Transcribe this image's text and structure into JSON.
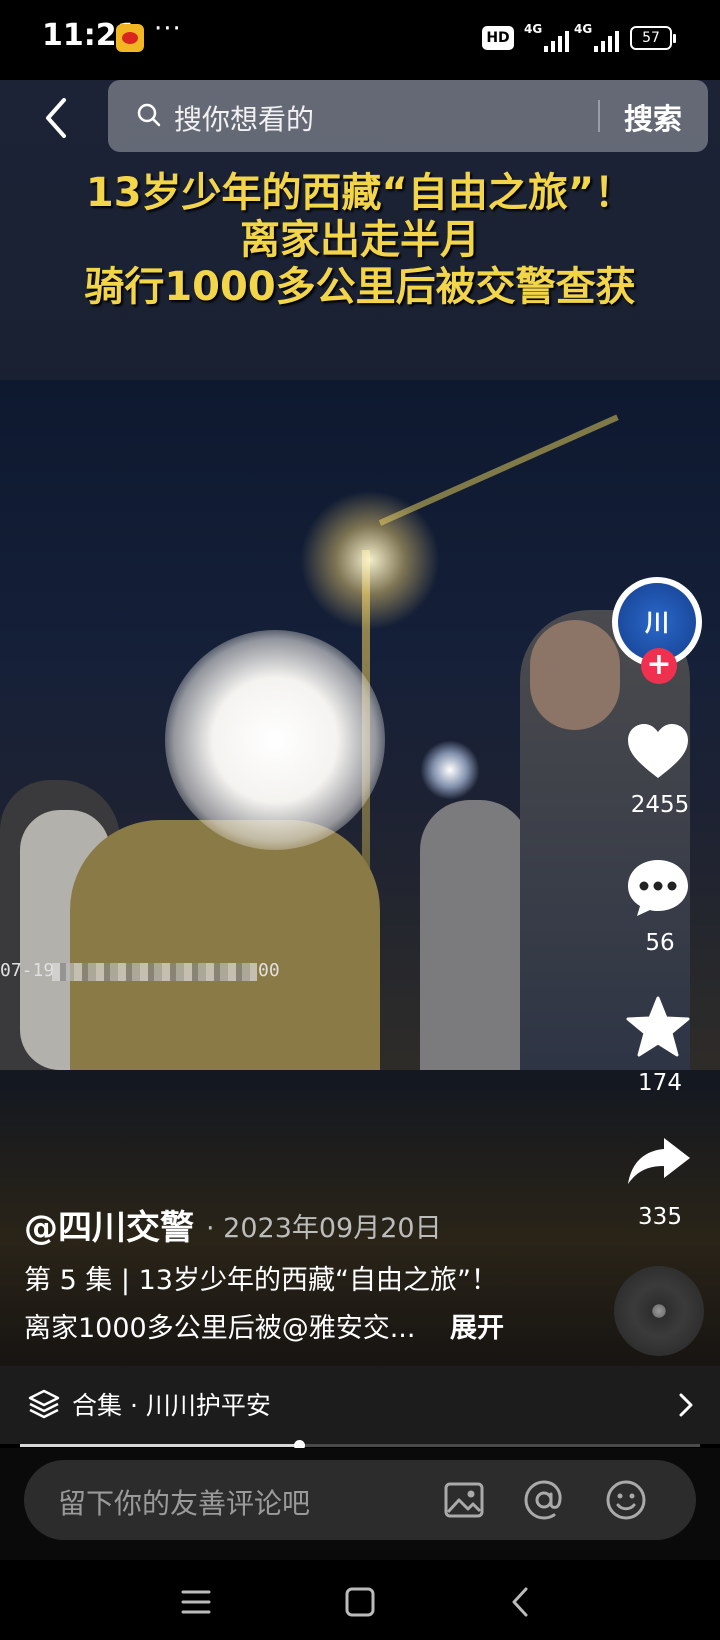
{
  "status_bar": {
    "time": "11:21",
    "more": "···",
    "hd": "HD",
    "sim1_label": "4G",
    "sim2_label": "4G",
    "battery": "57",
    "app_icon": "weibo-icon"
  },
  "nav": {
    "back_icon": "back-arrow-icon",
    "search_placeholder": "搜你想看的",
    "search_button": "搜索"
  },
  "video": {
    "headline_lines": [
      "13岁少年的西藏“自由之旅”！",
      "离家出走半月",
      "骑行1000多公里后被交警查获"
    ],
    "timestamp_prefix": "07-19",
    "timestamp_suffix": "00"
  },
  "creator": {
    "avatar_text": "川",
    "follow": "+"
  },
  "actions": {
    "likes": "2455",
    "comments": "56",
    "favorites": "174",
    "shares": "335"
  },
  "post": {
    "author": "@四川交警",
    "date": "· 2023年09月20日",
    "description_line1": "第 5 集 | 13岁少年的西藏“自由之旅”！",
    "description_line2": "离家1000多公里后被@雅安交...",
    "expand": "展开"
  },
  "collection": {
    "label": "合集 · 川川护平安"
  },
  "playback": {
    "progress": 0.41
  },
  "comment": {
    "placeholder": "留下你的友善评论吧"
  },
  "colors": {
    "headline": "#f3d54a",
    "follow": "#f0304f",
    "avatar_blue": "#1d4fa6"
  }
}
